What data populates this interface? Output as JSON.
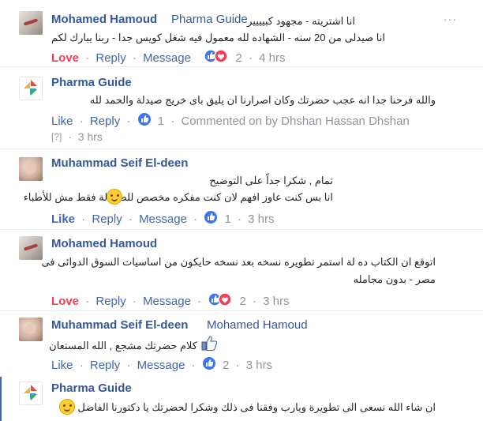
{
  "comments": [
    {
      "author": "Mohamed Hamoud",
      "tag": "Pharma Guide",
      "line1": "انا اشتريته - مجهود كبيييير",
      "line2": "انا صيدلى من 20 سنه - الشهاده لله معمول فيه شغل كويس جدا - ربنا يبارك لكم",
      "action1": "Love",
      "reply": "Reply",
      "message": "Message",
      "count": "2",
      "time": "4 hrs",
      "menu": "···"
    },
    {
      "author": "Pharma Guide",
      "line1": "والله فرحنا جدا انه عجب حضرتك وكان اصرارنا ان يليق باى خريج صيدلة والحمد لله",
      "action1": "Like",
      "reply": "Reply",
      "count": "1",
      "commented_by": "Commented on by Dhshan Hassan Dhshan",
      "unknown": "[?]",
      "time": "3 hrs"
    },
    {
      "author": "Muhammad Seif El-deen",
      "line1": "تمام , شكرا جداً على التوضيح",
      "line2": "انا بس كنت عاوز افهم لان كنت مفكره مخصص للصيادلة فقط مش للأطباء",
      "action1": "Like",
      "reply": "Reply",
      "message": "Message",
      "count": "1",
      "time": "3 hrs"
    },
    {
      "author": "Mohamed Hamoud",
      "line1": "اتوقع ان الكتاب ده لة استمر تطويره نسخه بعد نسخه حايكون من اساسيات السوق الدوائى فى",
      "line2": "مصر - بدون مجامله",
      "action1": "Love",
      "reply": "Reply",
      "message": "Message",
      "count": "2",
      "time": "3 hrs"
    },
    {
      "author": "Muhammad Seif El-deen",
      "mention": "Mohamed Hamoud",
      "line1": "كلام حضرتك مشجع , الله المستعان",
      "action1": "Like",
      "reply": "Reply",
      "message": "Message",
      "count": "2",
      "time": "3 hrs"
    },
    {
      "author": "Pharma Guide",
      "line1": "ان شاء الله نسعى الى تطويرة ويارب وفقنا فى ذلك وشكرا لحضرتك يا دكتورنا الفاضل"
    }
  ],
  "colors": {
    "link": "#365899",
    "love": "#f33e58",
    "like": "#4267b2",
    "meta": "#90949c",
    "text": "#1d2129"
  },
  "icons": [
    "like-reaction-icon",
    "love-reaction-icon",
    "smile-emoji-icon",
    "thumbs-up-emoji-icon",
    "pharma-guide-logo-icon"
  ]
}
